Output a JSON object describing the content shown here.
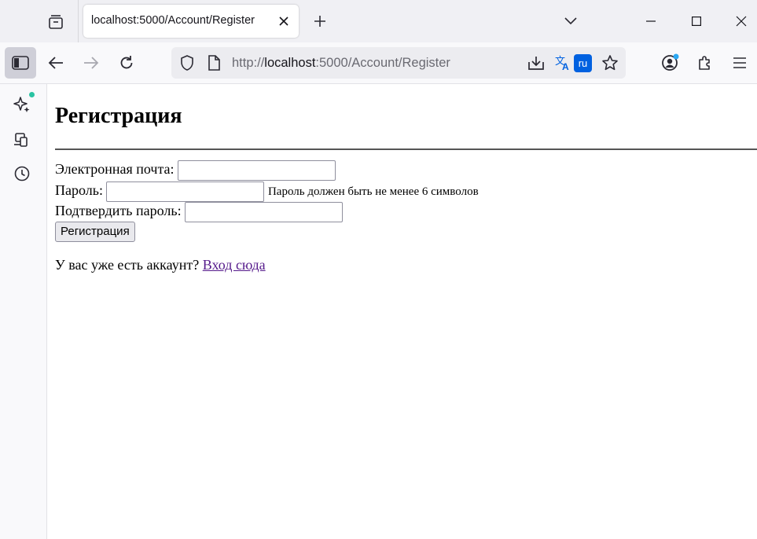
{
  "browser": {
    "tab_title": "localhost:5000/Account/Register",
    "url_scheme": "http://",
    "url_host": "localhost",
    "url_rest": ":5000/Account/Register",
    "translate_badge": "ru"
  },
  "page": {
    "heading": "Регистрация",
    "email_label": "Электронная почта:",
    "email_value": "",
    "password_label": "Пароль:",
    "password_value": "",
    "password_hint": "Пароль должен быть не менее 6 символов",
    "confirm_label": "Подтвердить пароль:",
    "confirm_value": "",
    "submit_label": "Регистрация",
    "login_prompt": "У вас уже есть аккаунт?",
    "login_link": "Вход сюда"
  },
  "colors": {
    "accent_dot": "#2ac3a2",
    "ru_badge": "#0061e0",
    "visited_link": "#551a8b"
  }
}
